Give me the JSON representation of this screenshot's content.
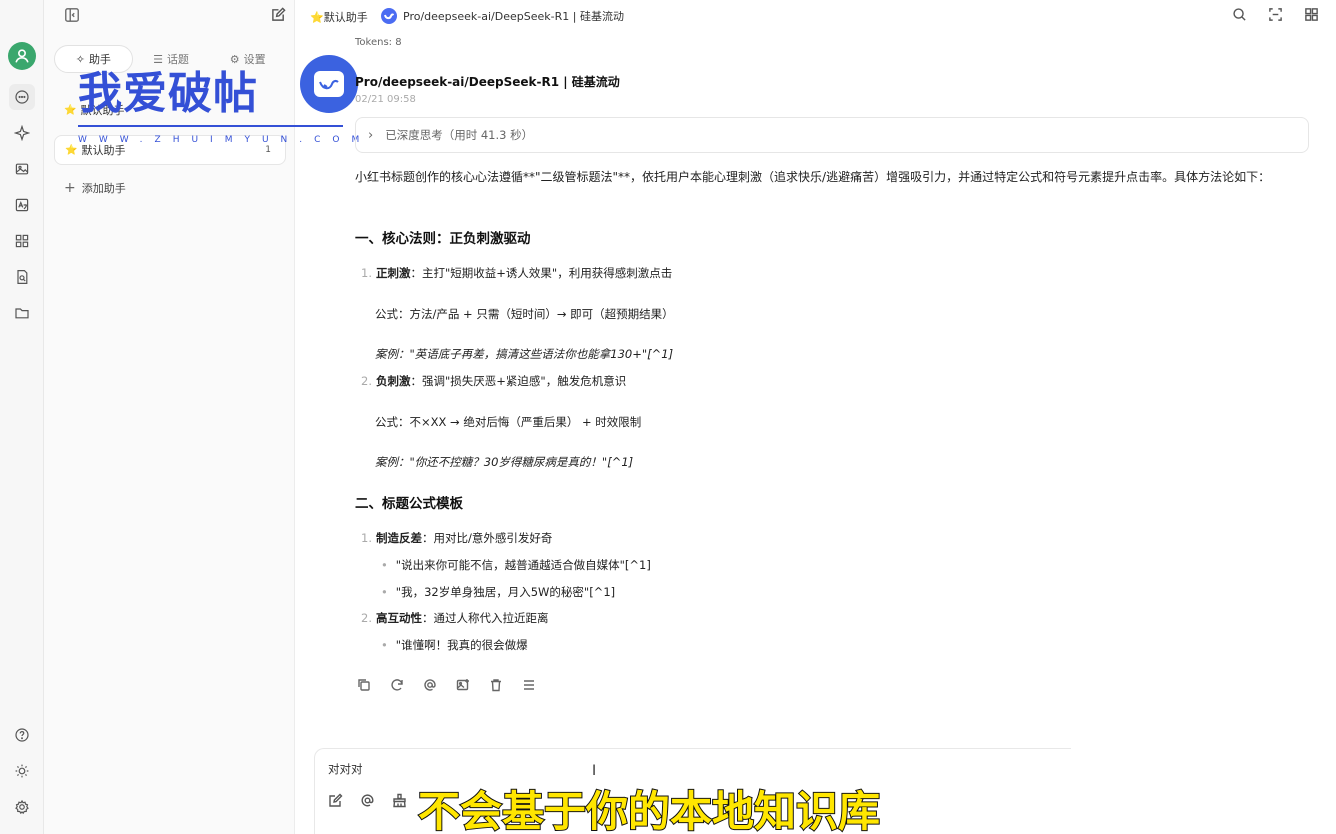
{
  "sidebar_tabs": [
    "助手",
    "话题",
    "设置"
  ],
  "assistants": [
    {
      "emoji": "⭐",
      "label": "默认助手",
      "count": ""
    },
    {
      "emoji": "⭐",
      "label": "默认助手",
      "count": "1"
    }
  ],
  "add_assistant": "添加助手",
  "watermark": {
    "text": "我爱破帖",
    "url": "WWW.ZHUIMYUN.COM"
  },
  "topbar": {
    "assistant": "⭐默认助手",
    "model": "Pro/deepseek-ai/DeepSeek-R1 | 硅基流动"
  },
  "message": {
    "tokens": "Tokens: 8",
    "model": "Pro/deepseek-ai/DeepSeek-R1 | 硅基流动",
    "time": "02/21 09:58",
    "thinking": "已深度思考（用时 41.3 秒）",
    "intro": "小红书标题创作的核心心法遵循**\"二级管标题法\"**，依托用户本能心理刺激（追求快乐/逃避痛苦）增强吸引力，并通过特定公式和符号元素提升点击率。具体方法论如下：",
    "h1": "一、核心法则：正负刺激驱动",
    "p1_num": "1.",
    "p1_bold": "正刺激",
    "p1_text": "：主打\"短期收益+诱人效果\"，利用获得感刺激点击",
    "p1_formula": "公式：方法/产品 + 只需（短时间）→ 即可（超预期结果）",
    "p1_case": "案例：\"英语底子再差，搞清这些语法你也能拿130+\"[^1]",
    "p2_num": "2.",
    "p2_bold": "负刺激",
    "p2_text": "：强调\"损失厌恶+紧迫感\"，触发危机意识",
    "p2_formula": "公式：不×XX → 绝对后悔（严重后果） + 时效限制",
    "p2_case": "案例：\"你还不控糖？30岁得糖尿病是真的！\"[^1]",
    "h2": "二、标题公式模板",
    "t1_num": "1.",
    "t1_bold": "制造反差",
    "t1_text": "：用对比/意外感引发好奇",
    "t1_b1": "\"说出来你可能不信，越普通越适合做自媒体\"[^1]",
    "t1_b2": "\"我，32岁单身独居，月入5W的秘密\"[^1]",
    "t2_num": "2.",
    "t2_bold": "高互动性",
    "t2_text": "：通过人称代入拉近距离",
    "t2_b1": "\"谁懂啊！我真的很会做爆"
  },
  "input": {
    "value": "对对对"
  },
  "subtitle": "不会基于你的本地知识库",
  "colors": {
    "accent": "#3aa76d",
    "watermark": "#3450d6",
    "subtitle": "#ffe600"
  }
}
